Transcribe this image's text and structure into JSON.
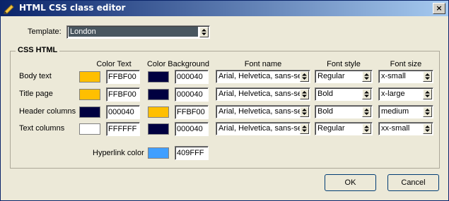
{
  "window": {
    "title": "HTML CSS class editor",
    "close_glyph": "×"
  },
  "template": {
    "label": "Template:",
    "selected": "London"
  },
  "group": {
    "label": "CSS HTML"
  },
  "columns": {
    "color_text": "Color Text",
    "color_background": "Color Background",
    "font_name": "Font name",
    "font_style": "Font style",
    "font_size": "Font size"
  },
  "rows": [
    {
      "label": "Body text",
      "text_color_hex": "FFBF00",
      "text_color": "#FFBF00",
      "bg_color_hex": "000040",
      "bg_color": "#000040",
      "font_name": "Arial, Helvetica, sans-se",
      "font_style": "Regular",
      "font_size": "x-small"
    },
    {
      "label": "Title page",
      "text_color_hex": "FFBF00",
      "text_color": "#FFBF00",
      "bg_color_hex": "000040",
      "bg_color": "#000040",
      "font_name": "Arial, Helvetica, sans-se",
      "font_style": "Bold",
      "font_size": "x-large"
    },
    {
      "label": "Header columns",
      "text_color_hex": "000040",
      "text_color": "#000040",
      "bg_color_hex": "FFBF00",
      "bg_color": "#FFBF00",
      "font_name": "Arial, Helvetica, sans-se",
      "font_style": "Bold",
      "font_size": "medium"
    },
    {
      "label": "Text columns",
      "text_color_hex": "FFFFFF",
      "text_color": "#FFFFFF",
      "bg_color_hex": "000040",
      "bg_color": "#000040",
      "font_name": "Arial, Helvetica, sans-se",
      "font_style": "Regular",
      "font_size": "xx-small"
    }
  ],
  "hyperlink": {
    "label": "Hyperlink color",
    "hex": "409FFF",
    "color": "#409FFF"
  },
  "buttons": {
    "ok": "OK",
    "cancel": "Cancel"
  }
}
